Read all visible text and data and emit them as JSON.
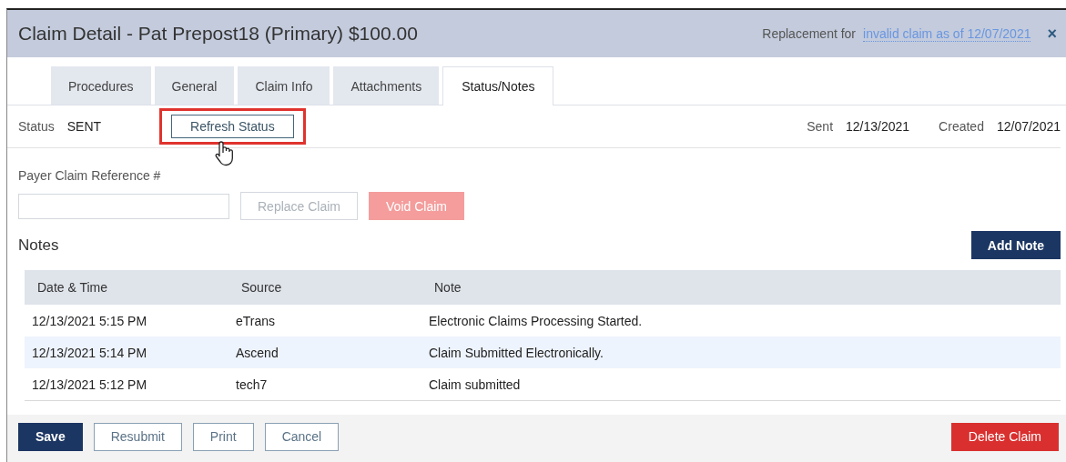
{
  "window": {
    "title": "Claim Detail - Pat Prepost18 (Primary) $100.00",
    "replacement_text": "Replacement for",
    "replacement_link": "invalid claim as of 12/07/2021",
    "close": "×"
  },
  "tabs": [
    {
      "label": "Procedures",
      "selected": false
    },
    {
      "label": "General",
      "selected": false
    },
    {
      "label": "Claim Info",
      "selected": false
    },
    {
      "label": "Attachments",
      "selected": false
    },
    {
      "label": "Status/Notes",
      "selected": true
    }
  ],
  "status": {
    "label": "Status",
    "value": "SENT",
    "refresh_button": "Refresh Status",
    "highlighted": true,
    "sent_label": "Sent",
    "sent_value": "12/13/2021",
    "created_label": "Created",
    "created_value": "12/07/2021"
  },
  "payer_ref": {
    "label": "Payer Claim Reference #"
  },
  "claim_buttons": [
    {
      "label": "Replace Claim",
      "kind": "outline",
      "disabled": true
    },
    {
      "label": "Void Claim",
      "kind": "danger",
      "disabled": true
    }
  ],
  "notes": {
    "title": "Notes",
    "add_button": "Add Note",
    "columns": [
      "Date & Time",
      "Source",
      "Note"
    ],
    "rows": [
      {
        "cells": [
          "12/13/2021 5:15 PM",
          "eTrans",
          "Electronic Claims Processing Started."
        ],
        "selected": false
      },
      {
        "cells": [
          "12/13/2021 5:14 PM",
          "Ascend",
          "Claim Submitted Electronically."
        ],
        "selected": true
      },
      {
        "cells": [
          "12/13/2021 5:12 PM",
          "tech7",
          "Claim submitted"
        ],
        "selected": false
      }
    ]
  },
  "footer_buttons": [
    {
      "label": "Save",
      "kind": "primary",
      "disabled": false
    },
    {
      "label": "Resubmit",
      "kind": "outline",
      "disabled": false
    },
    {
      "label": "Print",
      "kind": "outline",
      "disabled": false
    },
    {
      "label": "Cancel",
      "kind": "outline",
      "disabled": false
    },
    {
      "label": "Delete Claim",
      "kind": "danger",
      "disabled": false
    }
  ]
}
